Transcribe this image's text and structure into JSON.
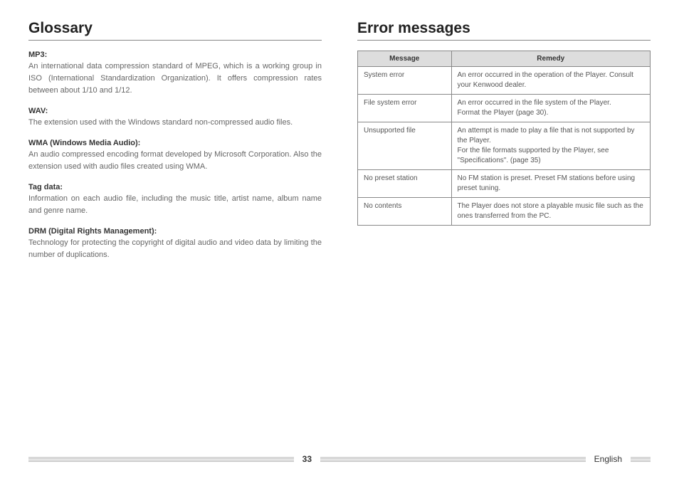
{
  "left": {
    "heading": "Glossary",
    "entries": [
      {
        "term": "MP3:",
        "def": "An international data compression standard of MPEG, which is a working group in ISO (International Standardization Organization). It offers compression rates between about 1/10 and 1/12."
      },
      {
        "term": "WAV:",
        "def": "The extension used with the Windows standard non-compressed audio files."
      },
      {
        "term": "WMA (Windows Media Audio):",
        "def": "An audio compressed encoding format developed by Microsoft Corporation. Also the extension used with audio files created using WMA."
      },
      {
        "term": "Tag data:",
        "def": "Information on each audio file, including the music title, artist name, album name and genre name."
      },
      {
        "term": "DRM (Digital Rights Management):",
        "def": "Technology for protecting the copyright of digital audio and video data by limiting the number of duplications."
      }
    ]
  },
  "right": {
    "heading": "Error messages",
    "headers": {
      "c1": "Message",
      "c2": "Remedy"
    },
    "rows": [
      {
        "msg": "System error",
        "rem": "An error occurred in the operation of the Player. Consult your Kenwood dealer."
      },
      {
        "msg": "File system error",
        "rem": "An error occurred in the file system of the Player.\nFormat the Player (page 30)."
      },
      {
        "msg": "Unsupported file",
        "rem": "An attempt is made to play a file that is not supported by the Player.\nFor the file formats supported by the Player, see \"Specifications\". (page 35)"
      },
      {
        "msg": "No preset station",
        "rem": "No FM station is preset. Preset FM stations before using preset tuning."
      },
      {
        "msg": "No contents",
        "rem": "The Player does not store a playable music file such as the ones transferred from the PC."
      }
    ]
  },
  "footer": {
    "page": "33",
    "lang": "English"
  }
}
